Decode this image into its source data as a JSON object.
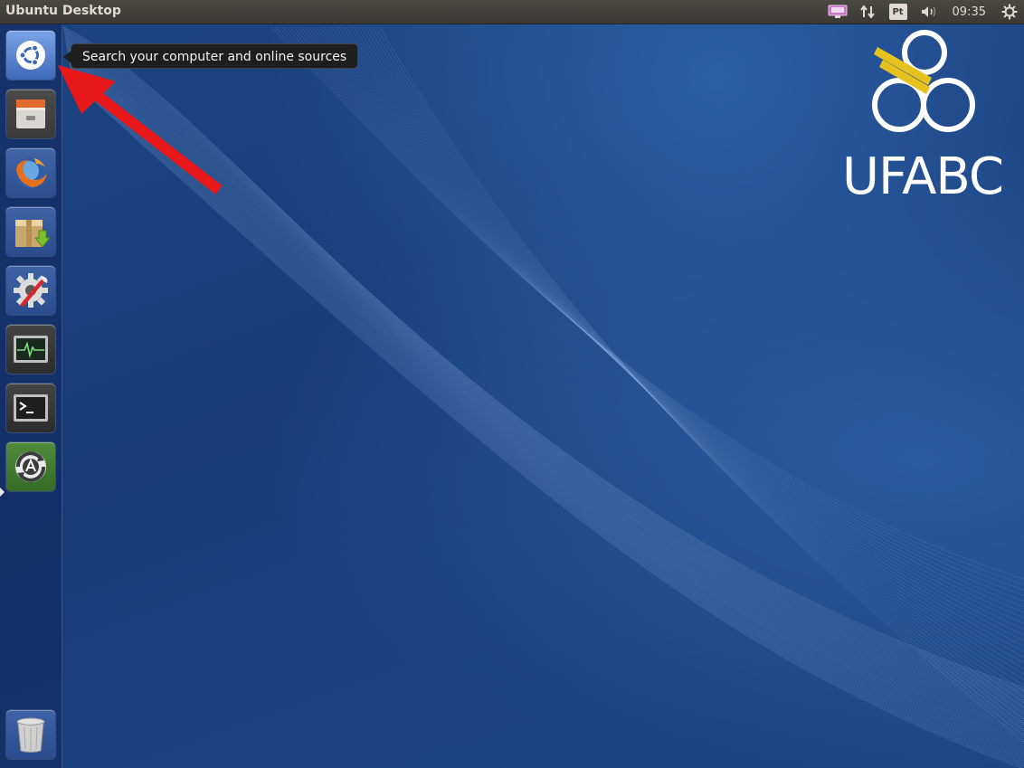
{
  "top_panel": {
    "title": "Ubuntu Desktop",
    "keyboard_layout": "Pt",
    "clock": "09:35",
    "indicators": [
      "display-icon",
      "network-arrows-icon",
      "keyboard-layout-indicator",
      "volume-icon",
      "session-gear-icon"
    ]
  },
  "tooltip": {
    "text": "Search your computer and online sources"
  },
  "launcher": {
    "items": [
      {
        "name": "dash-home",
        "icon": "ubuntu-logo-icon"
      },
      {
        "name": "files",
        "icon": "file-cabinet-icon"
      },
      {
        "name": "firefox",
        "icon": "firefox-icon"
      },
      {
        "name": "archive-manager",
        "icon": "package-download-icon"
      },
      {
        "name": "system-settings",
        "icon": "gear-wrench-icon"
      },
      {
        "name": "system-monitor",
        "icon": "activity-monitor-icon"
      },
      {
        "name": "terminal",
        "icon": "terminal-icon"
      },
      {
        "name": "software-updater",
        "icon": "software-updater-icon"
      },
      {
        "name": "trash",
        "icon": "trash-icon"
      }
    ]
  },
  "wallpaper": {
    "logo_text": "UFABC"
  },
  "colors": {
    "panel_bg": "#3d3c38",
    "desktop_bg": "#1b4583",
    "arrow": "#e8171a",
    "logo_accent": "#e6c21e"
  }
}
